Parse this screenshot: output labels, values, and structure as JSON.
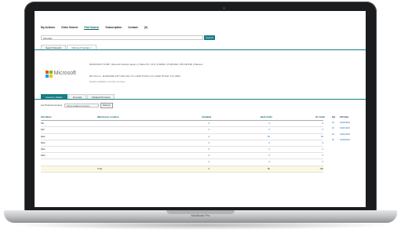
{
  "device": {
    "label": "MacBook Pro"
  },
  "nav": {
    "items": [
      {
        "label": "My Actions",
        "active": false
      },
      {
        "label": "Order Search",
        "active": false
      },
      {
        "label": "Part Search",
        "active": true
      },
      {
        "label": "Subscription",
        "active": false
      },
      {
        "label": "Contact",
        "active": false
      },
      {
        "label": "(0)",
        "active": false
      }
    ]
  },
  "search": {
    "value": "MS-DEF",
    "button": "Search"
  },
  "tabs": [
    {
      "label": "Search Results",
      "active": false
    },
    {
      "label": "Microsoft Surface ×",
      "active": true
    }
  ],
  "product": {
    "brand": "Microsoft",
    "logo_colors": [
      "#f25022",
      "#7fba00",
      "#00a4ef",
      "#ffb900"
    ],
    "description": "MICROSOFT CORP - Microsoft Surface Laptop 2 | Tablet PC | 13.5 | i5-8250U | 8 GB RAM | 256 GB SSD | Platinum",
    "row1": "Mfr. Part no.: M-MSSURF-2-PT       MFG Part: FT-1-0003       TD Part: FT-1-0002       TD Part: FT-1-0004",
    "row2": "Details available in product overview"
  },
  "subtabs": [
    {
      "label": "Inventory Status",
      "active": true
    },
    {
      "label": "Forecast",
      "active": false
    },
    {
      "label": "Related Products",
      "active": false
    }
  ],
  "filter": {
    "label": "List Product Inventory:",
    "select": "Show detailed inventory",
    "button": "Refresh"
  },
  "table": {
    "headers": {
      "site": "Site Name",
      "warehouse": "Warehouse Location",
      "available": "Available",
      "backorder": "Back Order",
      "onorder": "On Order"
    },
    "rows": [
      {
        "site": "DE",
        "available": "0",
        "backorder": "0",
        "onorder": "0"
      },
      {
        "site": "DE*",
        "available": "0",
        "backorder": "0",
        "onorder": "0"
      },
      {
        "site": "DE2",
        "available": "0",
        "backorder": "50",
        "onorder": "50"
      },
      {
        "site": "DE3",
        "available": "0",
        "backorder": "0",
        "onorder": "0"
      },
      {
        "site": "DE4",
        "available": "0",
        "backorder": "0",
        "onorder": "0"
      },
      {
        "site": "DE5",
        "available": "0",
        "backorder": "0",
        "onorder": "0"
      },
      {
        "site": "",
        "available": "0",
        "backorder": "0",
        "onorder": "0"
      }
    ],
    "total": {
      "label": "Total",
      "available": "0",
      "backorder": "50",
      "onorder": "100"
    }
  },
  "side": {
    "headers": {
      "qty": "Qty",
      "date": "ETA Date"
    },
    "rows": [
      {
        "qty": "10",
        "date": "03/23/2020"
      },
      {
        "qty": "20",
        "date": "03/27/2020"
      },
      {
        "qty": "20",
        "date": "04/01/2020"
      },
      {
        "qty": "50",
        "date": "04/15/2020"
      }
    ]
  }
}
